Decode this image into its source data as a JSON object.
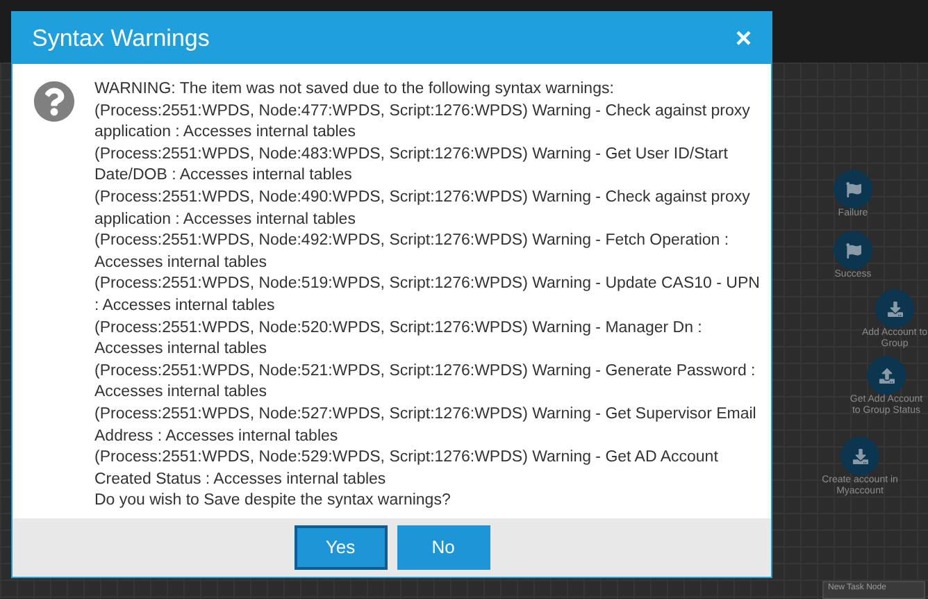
{
  "canvas": {
    "nodes": [
      {
        "label": "Failure",
        "kind": "flag"
      },
      {
        "label": "Success",
        "kind": "flag"
      },
      {
        "label": "Add Account to Group",
        "kind": "download"
      },
      {
        "label": "Get Add Account to Group Status",
        "kind": "upload"
      },
      {
        "label": "Create account in Myaccount",
        "kind": "download"
      }
    ],
    "task_node": "New Task Node"
  },
  "dialog": {
    "title": "Syntax Warnings",
    "close": "×",
    "heading": "WARNING: The item was not saved due to the following syntax warnings:",
    "warnings": [
      "(Process:2551:WPDS, Node:477:WPDS, Script:1276:WPDS) Warning - Check against proxy application : Accesses internal tables",
      "(Process:2551:WPDS, Node:483:WPDS, Script:1276:WPDS) Warning - Get User ID/Start Date/DOB : Accesses internal tables",
      "(Process:2551:WPDS, Node:490:WPDS, Script:1276:WPDS) Warning - Check against proxy application : Accesses internal tables",
      "(Process:2551:WPDS, Node:492:WPDS, Script:1276:WPDS) Warning - Fetch Operation : Accesses internal tables",
      "(Process:2551:WPDS, Node:519:WPDS, Script:1276:WPDS) Warning - Update CAS10 - UPN : Accesses internal tables",
      "(Process:2551:WPDS, Node:520:WPDS, Script:1276:WPDS) Warning - Manager Dn : Accesses internal tables",
      "(Process:2551:WPDS, Node:521:WPDS, Script:1276:WPDS) Warning - Generate Password : Accesses internal tables",
      "(Process:2551:WPDS, Node:527:WPDS, Script:1276:WPDS) Warning - Get Supervisor Email Address : Accesses internal tables",
      "(Process:2551:WPDS, Node:529:WPDS, Script:1276:WPDS) Warning - Get AD Account Created Status : Accesses internal tables"
    ],
    "question": "Do you wish to Save despite the syntax warnings?",
    "buttons": [
      {
        "label": "Yes",
        "selected": true
      },
      {
        "label": "No",
        "selected": false
      }
    ]
  }
}
